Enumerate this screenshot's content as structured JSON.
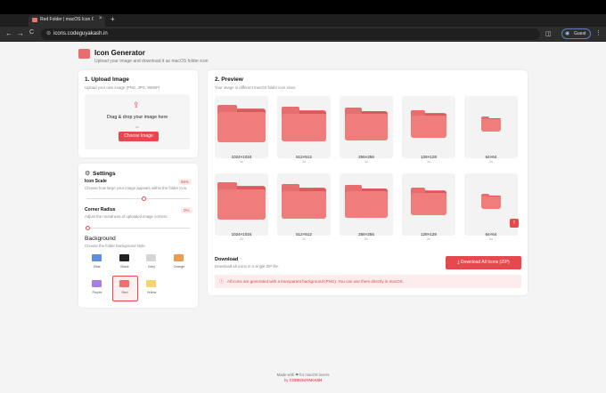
{
  "browser": {
    "tab_title": "Red Folder | macOS Icon Gen...",
    "tab_close": "×",
    "new_tab": "+",
    "url": "icons.codeguyakash.in",
    "guest_label": "Guest",
    "nav_back": "←",
    "nav_forward": "→",
    "nav_reload": "C",
    "menu": "⋮"
  },
  "header": {
    "title": "Icon Generator",
    "subtitle": "Upload your image and download it as macOS folder icon"
  },
  "upload": {
    "title": "1. Upload Image",
    "subtitle": "Upload your own image (PNG, JPG, WEBP)",
    "drop_text": "Drag & drop your image here",
    "or_text": "or",
    "button": "Choose Image"
  },
  "settings": {
    "title": "Settings",
    "icon_scale": {
      "label": "Icon Scale",
      "value": "56%",
      "desc": "Choose how large your image appears within the folder icon.",
      "fraction": 0.56
    },
    "corner_radius": {
      "label": "Corner Radius",
      "value": "0%",
      "desc": "Adjust the roundness of uploaded image corners.",
      "fraction": 0.0
    },
    "background": {
      "label": "Background",
      "desc": "Choose the folder background style.",
      "options": [
        {
          "name": "Blue",
          "color": "#5b8fde"
        },
        {
          "name": "Black",
          "color": "#222222"
        },
        {
          "name": "Grey",
          "color": "#d5d5d5"
        },
        {
          "name": "Orange",
          "color": "#ee9b52"
        },
        {
          "name": "Purple",
          "color": "#a77fe0"
        },
        {
          "name": "Red",
          "color": "#ef6f6f"
        },
        {
          "name": "Yellow",
          "color": "#f5d46a"
        }
      ],
      "selected": "Red"
    }
  },
  "preview": {
    "title": "2. Preview",
    "subtitle": "Your image in different macOS folder icon sizes",
    "row1": [
      {
        "size": "1024×1024",
        "scale": "1x"
      },
      {
        "size": "512×512",
        "scale": "1x"
      },
      {
        "size": "256×256",
        "scale": "1x"
      },
      {
        "size": "128×128",
        "scale": "1x"
      },
      {
        "size": "64×64",
        "scale": "1x"
      }
    ],
    "row2": [
      {
        "size": "1024×1024",
        "scale": "2x"
      },
      {
        "size": "512×512",
        "scale": "2x"
      },
      {
        "size": "256×256",
        "scale": "2x"
      },
      {
        "size": "128×128",
        "scale": "2x"
      },
      {
        "size": "64×64",
        "scale": "2x"
      }
    ]
  },
  "download": {
    "title": "Download",
    "subtitle": "Download all icons in a single ZIP file.",
    "button": "Download All Icons (ZIP)",
    "info": "All icons are generated with a transparent background (PNG). You can use them directly in macOS."
  },
  "footer": {
    "made_with": "Made with ❤ for macOS lovers",
    "by_prefix": "by",
    "author": "CODEGUYAKASH"
  },
  "colors": {
    "accent": "#e5484d",
    "folder": "#e66e6e"
  }
}
